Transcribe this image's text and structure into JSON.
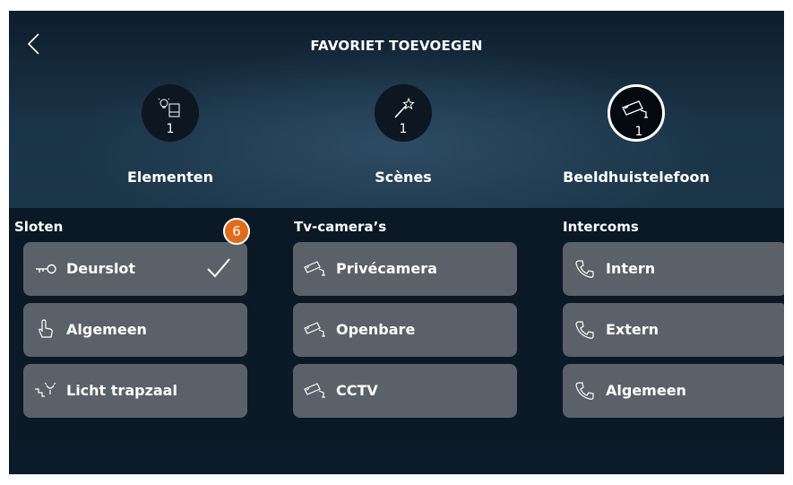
{
  "header": {
    "title": "FAVORIET TOEVOEGEN"
  },
  "tabs": [
    {
      "label": "Elementen",
      "count": "1",
      "icon": "light-door-icon"
    },
    {
      "label": "Scènes",
      "count": "1",
      "icon": "magic-wand-icon"
    },
    {
      "label": "Beeldhuistelefoon",
      "count": "1",
      "icon": "camera-icon",
      "active": true
    }
  ],
  "sections": [
    {
      "title": "Sloten",
      "items": [
        {
          "label": "Deurslot",
          "icon": "key-icon",
          "selected": true
        },
        {
          "label": "Algemeen",
          "icon": "hand-pointer-icon"
        },
        {
          "label": "Licht trapzaal",
          "icon": "stair-light-icon"
        }
      ]
    },
    {
      "title": "Tv-camera’s",
      "items": [
        {
          "label": "Privécamera",
          "icon": "camera-icon"
        },
        {
          "label": "Openbare",
          "icon": "camera-icon"
        },
        {
          "label": "CCTV",
          "icon": "camera-icon"
        }
      ]
    },
    {
      "title": "Intercoms",
      "items": [
        {
          "label": "Intern",
          "icon": "phone-icon"
        },
        {
          "label": "Extern",
          "icon": "phone-icon"
        },
        {
          "label": "Algemeen",
          "icon": "phone-icon"
        }
      ]
    }
  ],
  "badge": "6",
  "colors": {
    "accent": "#e06c1a",
    "button": "#5a6168",
    "background": "#0c1b29"
  }
}
